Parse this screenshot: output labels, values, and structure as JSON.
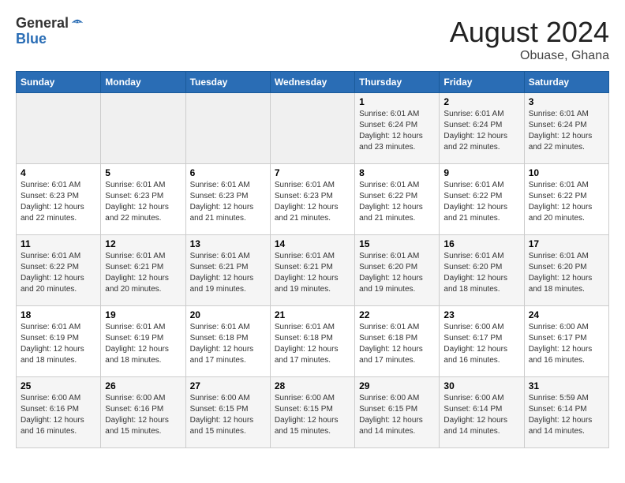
{
  "logo": {
    "general": "General",
    "blue": "Blue"
  },
  "title": "August 2024",
  "subtitle": "Obuase, Ghana",
  "days_of_week": [
    "Sunday",
    "Monday",
    "Tuesday",
    "Wednesday",
    "Thursday",
    "Friday",
    "Saturday"
  ],
  "weeks": [
    [
      {
        "day": "",
        "info": ""
      },
      {
        "day": "",
        "info": ""
      },
      {
        "day": "",
        "info": ""
      },
      {
        "day": "",
        "info": ""
      },
      {
        "day": "1",
        "info": "Sunrise: 6:01 AM\nSunset: 6:24 PM\nDaylight: 12 hours and 23 minutes."
      },
      {
        "day": "2",
        "info": "Sunrise: 6:01 AM\nSunset: 6:24 PM\nDaylight: 12 hours and 22 minutes."
      },
      {
        "day": "3",
        "info": "Sunrise: 6:01 AM\nSunset: 6:24 PM\nDaylight: 12 hours and 22 minutes."
      }
    ],
    [
      {
        "day": "4",
        "info": "Sunrise: 6:01 AM\nSunset: 6:23 PM\nDaylight: 12 hours and 22 minutes."
      },
      {
        "day": "5",
        "info": "Sunrise: 6:01 AM\nSunset: 6:23 PM\nDaylight: 12 hours and 22 minutes."
      },
      {
        "day": "6",
        "info": "Sunrise: 6:01 AM\nSunset: 6:23 PM\nDaylight: 12 hours and 21 minutes."
      },
      {
        "day": "7",
        "info": "Sunrise: 6:01 AM\nSunset: 6:23 PM\nDaylight: 12 hours and 21 minutes."
      },
      {
        "day": "8",
        "info": "Sunrise: 6:01 AM\nSunset: 6:22 PM\nDaylight: 12 hours and 21 minutes."
      },
      {
        "day": "9",
        "info": "Sunrise: 6:01 AM\nSunset: 6:22 PM\nDaylight: 12 hours and 21 minutes."
      },
      {
        "day": "10",
        "info": "Sunrise: 6:01 AM\nSunset: 6:22 PM\nDaylight: 12 hours and 20 minutes."
      }
    ],
    [
      {
        "day": "11",
        "info": "Sunrise: 6:01 AM\nSunset: 6:22 PM\nDaylight: 12 hours and 20 minutes."
      },
      {
        "day": "12",
        "info": "Sunrise: 6:01 AM\nSunset: 6:21 PM\nDaylight: 12 hours and 20 minutes."
      },
      {
        "day": "13",
        "info": "Sunrise: 6:01 AM\nSunset: 6:21 PM\nDaylight: 12 hours and 19 minutes."
      },
      {
        "day": "14",
        "info": "Sunrise: 6:01 AM\nSunset: 6:21 PM\nDaylight: 12 hours and 19 minutes."
      },
      {
        "day": "15",
        "info": "Sunrise: 6:01 AM\nSunset: 6:20 PM\nDaylight: 12 hours and 19 minutes."
      },
      {
        "day": "16",
        "info": "Sunrise: 6:01 AM\nSunset: 6:20 PM\nDaylight: 12 hours and 18 minutes."
      },
      {
        "day": "17",
        "info": "Sunrise: 6:01 AM\nSunset: 6:20 PM\nDaylight: 12 hours and 18 minutes."
      }
    ],
    [
      {
        "day": "18",
        "info": "Sunrise: 6:01 AM\nSunset: 6:19 PM\nDaylight: 12 hours and 18 minutes."
      },
      {
        "day": "19",
        "info": "Sunrise: 6:01 AM\nSunset: 6:19 PM\nDaylight: 12 hours and 18 minutes."
      },
      {
        "day": "20",
        "info": "Sunrise: 6:01 AM\nSunset: 6:18 PM\nDaylight: 12 hours and 17 minutes."
      },
      {
        "day": "21",
        "info": "Sunrise: 6:01 AM\nSunset: 6:18 PM\nDaylight: 12 hours and 17 minutes."
      },
      {
        "day": "22",
        "info": "Sunrise: 6:01 AM\nSunset: 6:18 PM\nDaylight: 12 hours and 17 minutes."
      },
      {
        "day": "23",
        "info": "Sunrise: 6:00 AM\nSunset: 6:17 PM\nDaylight: 12 hours and 16 minutes."
      },
      {
        "day": "24",
        "info": "Sunrise: 6:00 AM\nSunset: 6:17 PM\nDaylight: 12 hours and 16 minutes."
      }
    ],
    [
      {
        "day": "25",
        "info": "Sunrise: 6:00 AM\nSunset: 6:16 PM\nDaylight: 12 hours and 16 minutes."
      },
      {
        "day": "26",
        "info": "Sunrise: 6:00 AM\nSunset: 6:16 PM\nDaylight: 12 hours and 15 minutes."
      },
      {
        "day": "27",
        "info": "Sunrise: 6:00 AM\nSunset: 6:15 PM\nDaylight: 12 hours and 15 minutes."
      },
      {
        "day": "28",
        "info": "Sunrise: 6:00 AM\nSunset: 6:15 PM\nDaylight: 12 hours and 15 minutes."
      },
      {
        "day": "29",
        "info": "Sunrise: 6:00 AM\nSunset: 6:15 PM\nDaylight: 12 hours and 14 minutes."
      },
      {
        "day": "30",
        "info": "Sunrise: 6:00 AM\nSunset: 6:14 PM\nDaylight: 12 hours and 14 minutes."
      },
      {
        "day": "31",
        "info": "Sunrise: 5:59 AM\nSunset: 6:14 PM\nDaylight: 12 hours and 14 minutes."
      }
    ]
  ]
}
